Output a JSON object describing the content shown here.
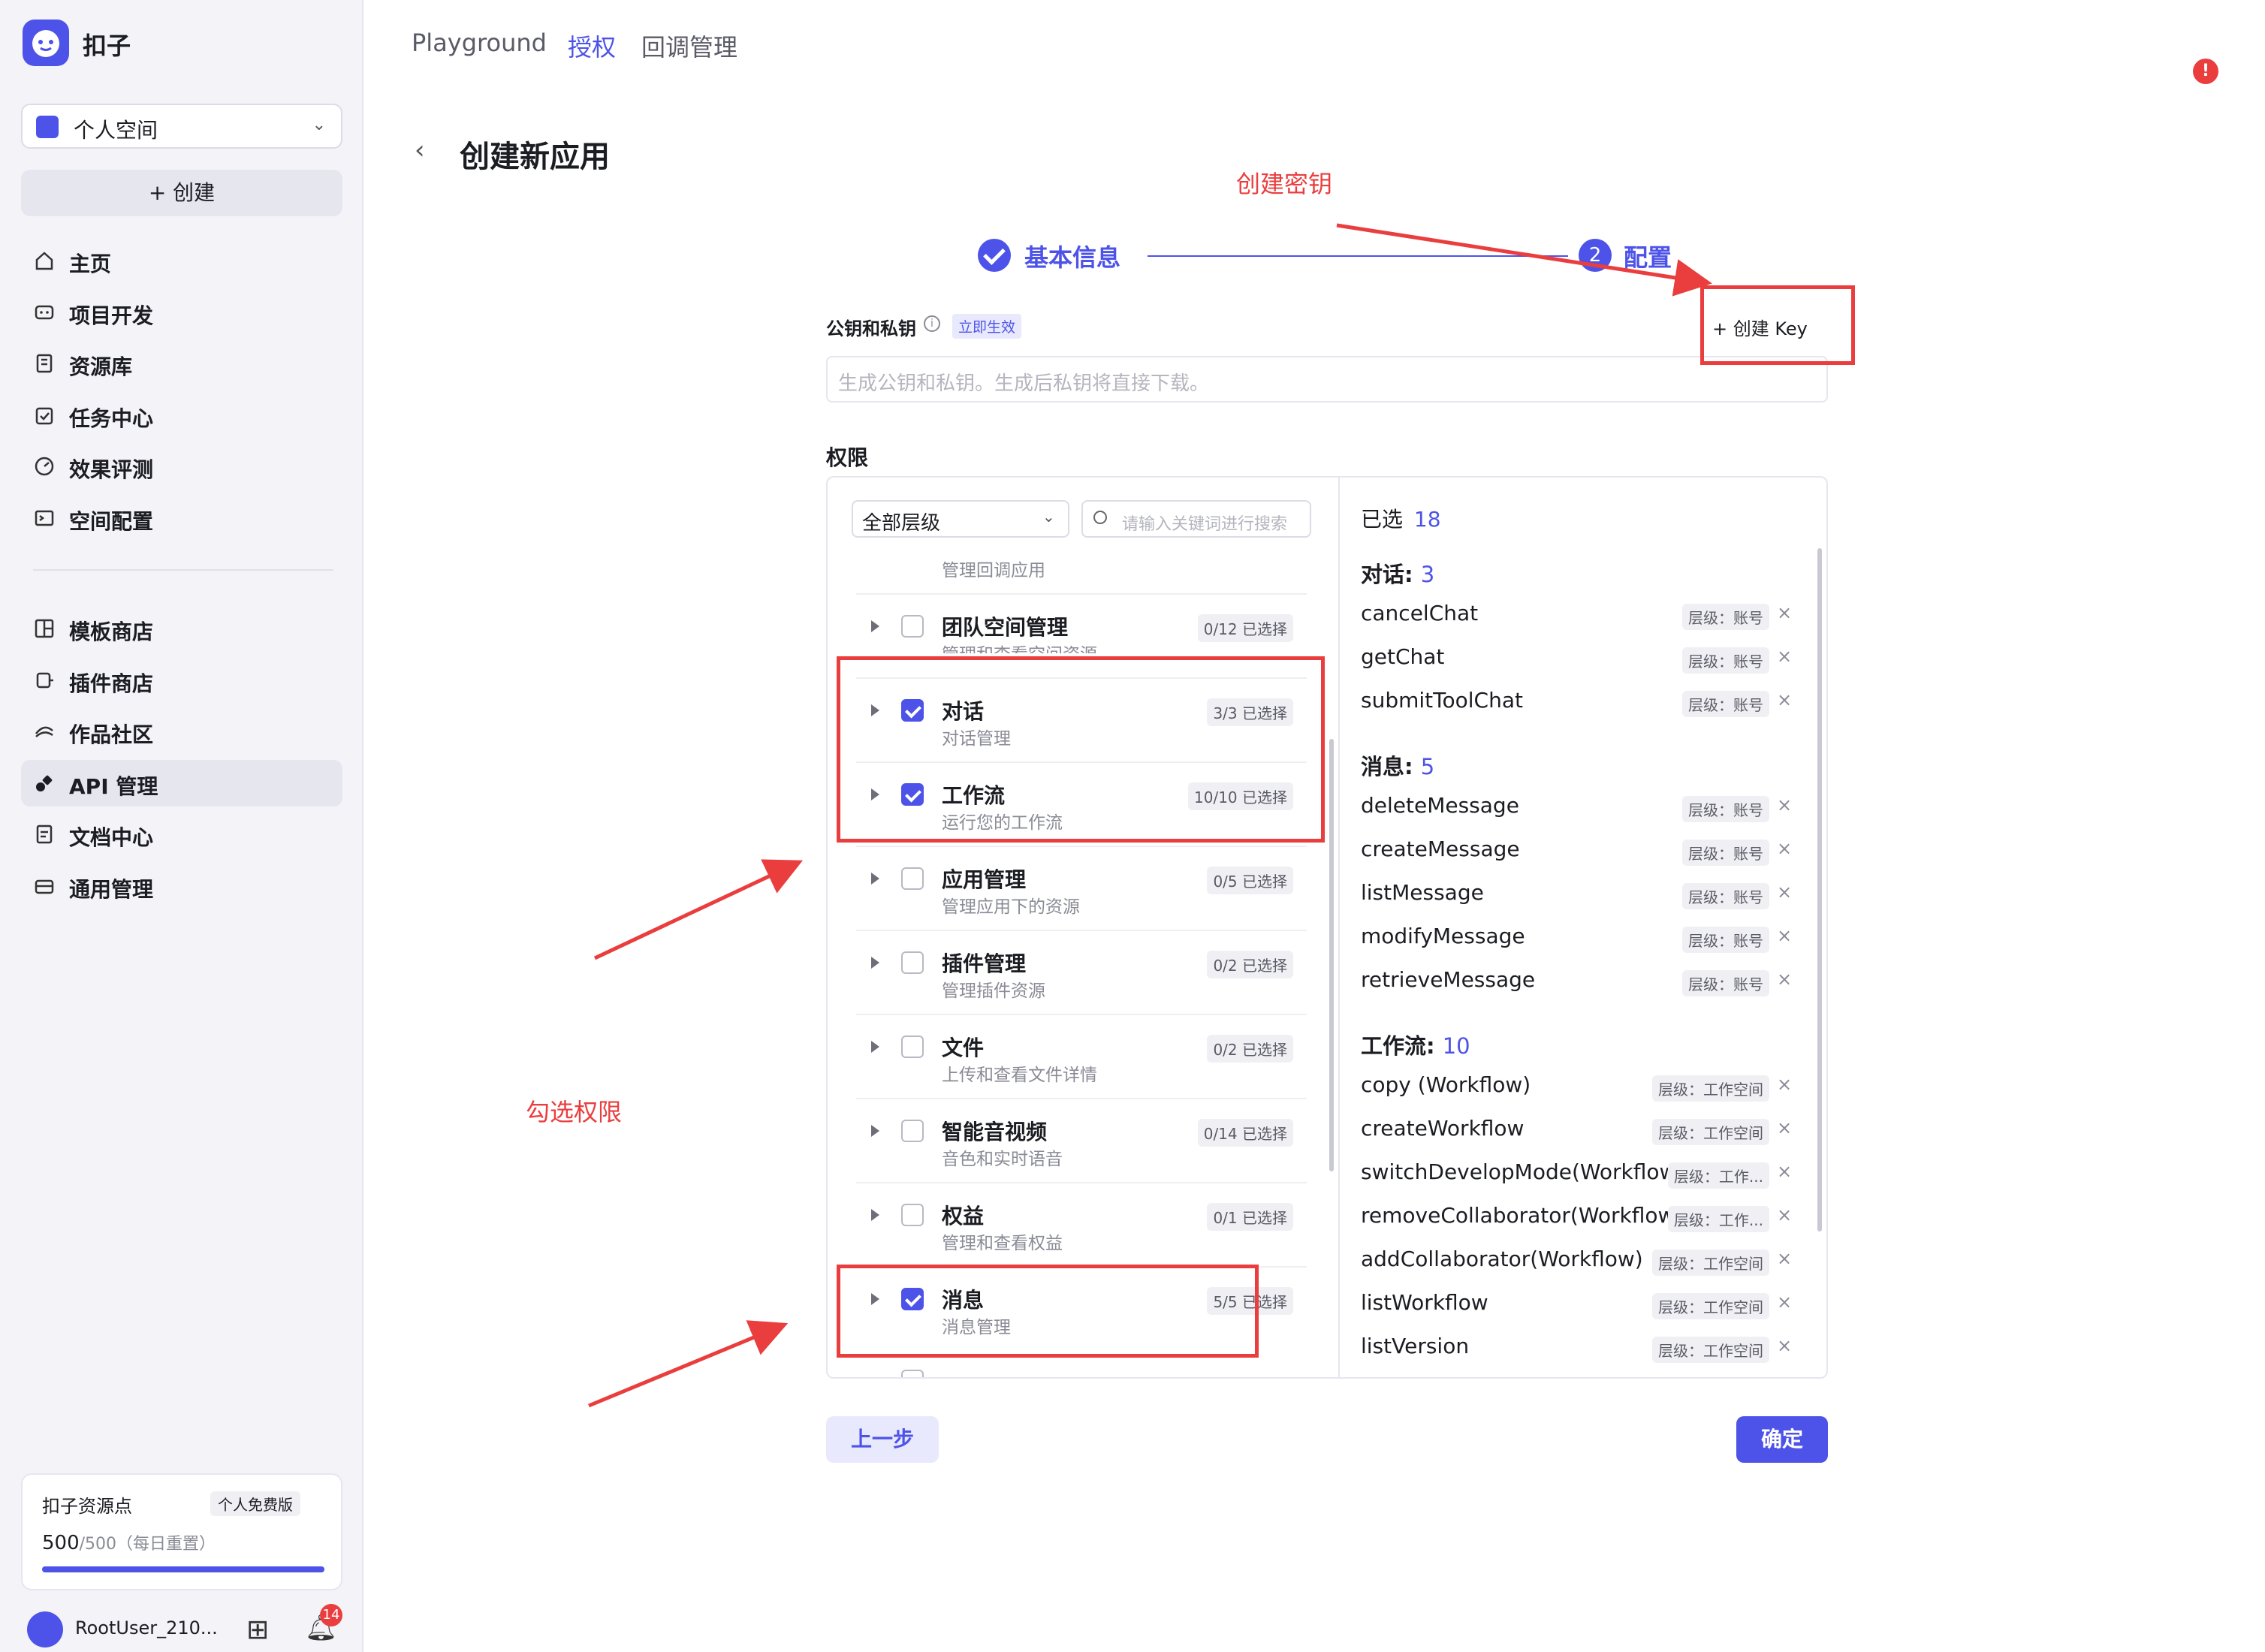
{
  "app": {
    "name": "扣子"
  },
  "sidebar": {
    "space_label": "个人空间",
    "create_label": "+ 创建",
    "nav_top": [
      {
        "label": "主页",
        "icon": "home-icon"
      },
      {
        "label": "项目开发",
        "icon": "project-icon"
      },
      {
        "label": "资源库",
        "icon": "library-icon"
      },
      {
        "label": "任务中心",
        "icon": "task-icon"
      },
      {
        "label": "效果评测",
        "icon": "evaluate-icon"
      },
      {
        "label": "空间配置",
        "icon": "space-config-icon"
      }
    ],
    "nav_bottom": [
      {
        "label": "模板商店",
        "icon": "template-icon"
      },
      {
        "label": "插件商店",
        "icon": "plugin-icon"
      },
      {
        "label": "作品社区",
        "icon": "community-icon"
      },
      {
        "label": "API 管理",
        "icon": "api-icon",
        "active": true
      },
      {
        "label": "文档中心",
        "icon": "doc-icon"
      },
      {
        "label": "通用管理",
        "icon": "general-icon"
      }
    ],
    "resource": {
      "title": "扣子资源点",
      "plan": "个人免费版",
      "used": "500",
      "total": "/500",
      "reset": "（每日重置）",
      "fraction": 1.0
    },
    "user": {
      "name": "RootUser_210...",
      "notif_count": "14"
    }
  },
  "topnav": {
    "items": [
      "Playground",
      "授权",
      "回调管理"
    ],
    "active": 1
  },
  "page": {
    "title": "创建新应用",
    "steps": [
      {
        "label": "基本信息",
        "status": "done"
      },
      {
        "label": "配置",
        "number": "2",
        "status": "current"
      }
    ],
    "keys": {
      "label": "公钥和私钥",
      "badge": "立即生效",
      "create_key": "+ 创建 Key",
      "placeholder": "生成公钥和私钥。生成后私钥将直接下载。"
    },
    "permissions_label": "权限",
    "filter": {
      "level": "全部层级",
      "search_placeholder": "请输入关键词进行搜索"
    },
    "top_partial_sub": "管理回调应用",
    "perm_rows": [
      {
        "title": "团队空间管理",
        "sub": "管理和查看空间资源",
        "count": "0/12 已选择",
        "checked": false
      },
      {
        "title": "对话",
        "sub": "对话管理",
        "count": "3/3 已选择",
        "checked": true
      },
      {
        "title": "工作流",
        "sub": "运行您的工作流",
        "count": "10/10 已选择",
        "checked": true
      },
      {
        "title": "应用管理",
        "sub": "管理应用下的资源",
        "count": "0/5 已选择",
        "checked": false
      },
      {
        "title": "插件管理",
        "sub": "管理插件资源",
        "count": "0/2 已选择",
        "checked": false
      },
      {
        "title": "文件",
        "sub": "上传和查看文件详情",
        "count": "0/2 已选择",
        "checked": false
      },
      {
        "title": "智能音视频",
        "sub": "音色和实时语音",
        "count": "0/14 已选择",
        "checked": false
      },
      {
        "title": "权益",
        "sub": "管理和查看权益",
        "count": "0/1 已选择",
        "checked": false
      },
      {
        "title": "消息",
        "sub": "消息管理",
        "count": "5/5 已选择",
        "checked": true
      }
    ],
    "selected": {
      "label": "已选",
      "count": "18",
      "groups": [
        {
          "name": "对话:",
          "count": "3",
          "items": [
            {
              "name": "cancelChat",
              "tag": "层级：账号"
            },
            {
              "name": "getChat",
              "tag": "层级：账号"
            },
            {
              "name": "submitToolChat",
              "tag": "层级：账号"
            }
          ]
        },
        {
          "name": "消息:",
          "count": "5",
          "items": [
            {
              "name": "deleteMessage",
              "tag": "层级：账号"
            },
            {
              "name": "createMessage",
              "tag": "层级：账号"
            },
            {
              "name": "listMessage",
              "tag": "层级：账号"
            },
            {
              "name": "modifyMessage",
              "tag": "层级：账号"
            },
            {
              "name": "retrieveMessage",
              "tag": "层级：账号"
            }
          ]
        },
        {
          "name": "工作流:",
          "count": "10",
          "items": [
            {
              "name": "copy (Workflow)",
              "tag": "层级：工作空间"
            },
            {
              "name": "createWorkflow",
              "tag": "层级：工作空间"
            },
            {
              "name": "switchDevelopMode(Workflow)",
              "tag": "层级：工作..."
            },
            {
              "name": "removeCollaborator(Workflow)",
              "tag": "层级：工作..."
            },
            {
              "name": "addCollaborator(Workflow)",
              "tag": "层级：工作空间"
            },
            {
              "name": "listWorkflow",
              "tag": "层级：工作空间"
            },
            {
              "name": "listVersion",
              "tag": "层级：工作空间"
            }
          ]
        }
      ]
    },
    "prev_button": "上一步",
    "confirm_button": "确定"
  },
  "annotations": {
    "create_key": "创建密钥",
    "check_perm": "勾选权限"
  },
  "colors": {
    "accent": "#4d53e8",
    "annotation": "#ea3e3e",
    "sidebar_bg": "#f3f3f8"
  }
}
